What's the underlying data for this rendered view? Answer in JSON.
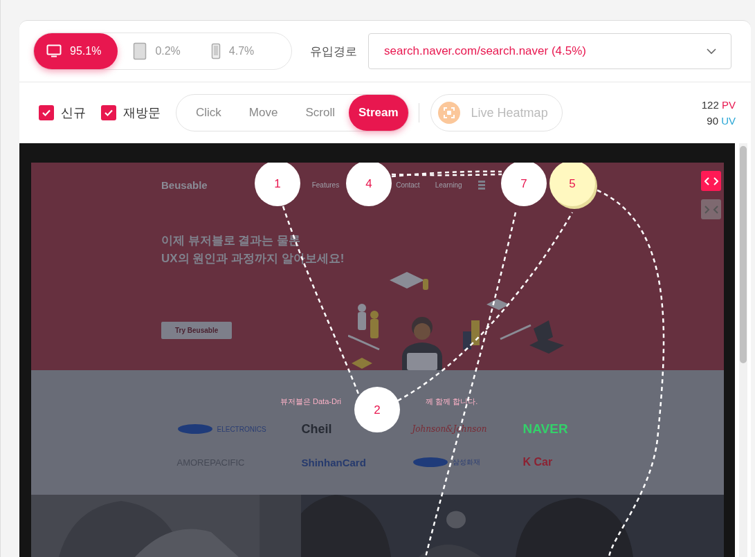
{
  "devices": [
    {
      "kind": "desktop",
      "label": "95.1%",
      "selected": true
    },
    {
      "kind": "tablet",
      "label": "0.2%",
      "selected": false
    },
    {
      "kind": "mobile",
      "label": "4.7%",
      "selected": false
    }
  ],
  "referrer": {
    "label": "유입경로",
    "value": "search.naver.com/search.naver (4.5%)"
  },
  "visitor_filters": [
    {
      "label": "신규",
      "checked": true
    },
    {
      "label": "재방문",
      "checked": true
    }
  ],
  "modes": [
    {
      "label": "Click",
      "selected": false
    },
    {
      "label": "Move",
      "selected": false
    },
    {
      "label": "Scroll",
      "selected": false
    },
    {
      "label": "Stream",
      "selected": true
    }
  ],
  "live_heatmap": {
    "label": "Live Heatmap"
  },
  "stats": [
    {
      "value": "122",
      "unit": "PV",
      "color": "#e8174f"
    },
    {
      "value": "90",
      "unit": "UV",
      "color": "#2aa7d6"
    }
  ],
  "viewer": {
    "site": {
      "logo": "Beusable",
      "nav": [
        "Features",
        "Contact",
        "Learning"
      ],
      "headline": [
        "이제 뷰저블로 결과는 물론",
        "UX의 원인과 과정까지 알아보세요!"
      ],
      "cta": "Try Beusable",
      "partners_caption": [
        "뷰저블은 Data-Dri",
        "께 함께 합니다."
      ],
      "partners": [
        "ELECTRONICS",
        "Cheil",
        "Johnson&Johnson",
        "NAVER",
        "AMOREPACIFIC",
        "ShinhanCard",
        "삼성화재",
        "K Car"
      ]
    },
    "stream_nodes": [
      {
        "label": "1",
        "highlighted": false
      },
      {
        "label": "4",
        "highlighted": false
      },
      {
        "label": "7",
        "highlighted": false
      },
      {
        "label": "5",
        "highlighted": true
      },
      {
        "label": "2",
        "highlighted": false
      }
    ],
    "side_buttons": [
      {
        "kind": "expand",
        "selected": true
      },
      {
        "kind": "collapse",
        "selected": false
      }
    ]
  }
}
